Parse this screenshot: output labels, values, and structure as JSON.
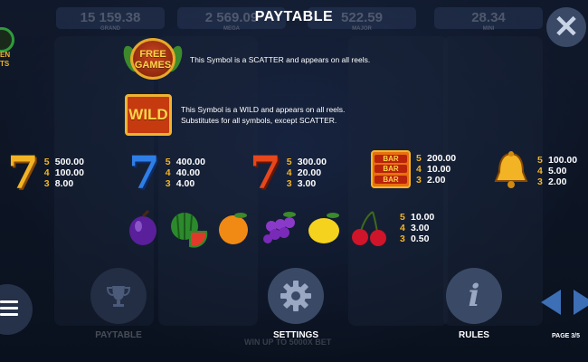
{
  "jackpots": [
    {
      "value": "15 159.38",
      "label": "GRAND"
    },
    {
      "value": "2 569.09",
      "label": "MEGA"
    },
    {
      "value": "522.59",
      "label": "MAJOR"
    },
    {
      "value": "28.34",
      "label": "MINI"
    }
  ],
  "title": "PAYTABLE",
  "logo_fragment": {
    "line1": "EN",
    "line2": "TS"
  },
  "scatter": {
    "badge_line1": "FREE",
    "badge_line2": "GAMES",
    "text": "This Symbol is a SCATTER and appears on all reels."
  },
  "wild": {
    "tile_label": "WILD",
    "text_line1": "This Symbol is a WILD and appears on all reels.",
    "text_line2": "Substitutes for all symbols, except SCATTER."
  },
  "symbols": [
    {
      "kind": "seven-gold",
      "pays": [
        {
          "count": "5",
          "value": "500.00"
        },
        {
          "count": "4",
          "value": "100.00"
        },
        {
          "count": "3",
          "value": "8.00"
        }
      ]
    },
    {
      "kind": "seven-blue",
      "pays": [
        {
          "count": "5",
          "value": "400.00"
        },
        {
          "count": "4",
          "value": "40.00"
        },
        {
          "count": "3",
          "value": "4.00"
        }
      ]
    },
    {
      "kind": "seven-red",
      "pays": [
        {
          "count": "5",
          "value": "300.00"
        },
        {
          "count": "4",
          "value": "20.00"
        },
        {
          "count": "3",
          "value": "3.00"
        }
      ]
    },
    {
      "kind": "bar",
      "bar_label": "BAR",
      "pays": [
        {
          "count": "5",
          "value": "200.00"
        },
        {
          "count": "4",
          "value": "10.00"
        },
        {
          "count": "3",
          "value": "2.00"
        }
      ]
    },
    {
      "kind": "bell",
      "pays": [
        {
          "count": "5",
          "value": "100.00"
        },
        {
          "count": "4",
          "value": "5.00"
        },
        {
          "count": "3",
          "value": "2.00"
        }
      ]
    }
  ],
  "fruits": {
    "icons": [
      "plum-icon",
      "watermelon-icon",
      "orange-icon",
      "grapes-icon",
      "lemon-icon",
      "cherries-icon"
    ],
    "pays": [
      {
        "count": "5",
        "value": "10.00"
      },
      {
        "count": "4",
        "value": "3.00"
      },
      {
        "count": "3",
        "value": "0.50"
      }
    ]
  },
  "buttons": {
    "paytable": "PAYTABLE",
    "settings": "SETTINGS",
    "rules": "RULES"
  },
  "win_up_to": "WIN UP TO 5000X BET",
  "page_indicator": "PAGE 3/5",
  "colors": {
    "accent": "#f2b424",
    "button": "#3a4a66",
    "arrow": "#3c6fb5"
  }
}
